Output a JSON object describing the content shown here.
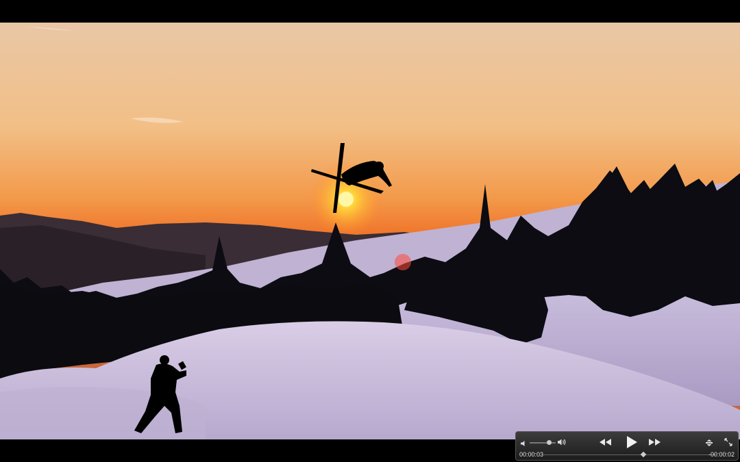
{
  "player": {
    "elapsed_time": "00:00:03",
    "remaining_time": "-00:00:02",
    "volume_level": 0.75,
    "playback_progress": 0.58
  },
  "icons": {
    "mute": "speaker-low-icon",
    "volume_max": "speaker-high-icon",
    "rewind": "rewind-icon",
    "play": "play-icon",
    "fast_forward": "fast-forward-icon",
    "menu": "chapter-menu-icon",
    "resize": "resize-icon"
  },
  "colors": {
    "sky_top": "#f2c596",
    "sky_horizon": "#f07a2a",
    "sun": "#ffe33a",
    "snow": "#c9bfdd"
  }
}
